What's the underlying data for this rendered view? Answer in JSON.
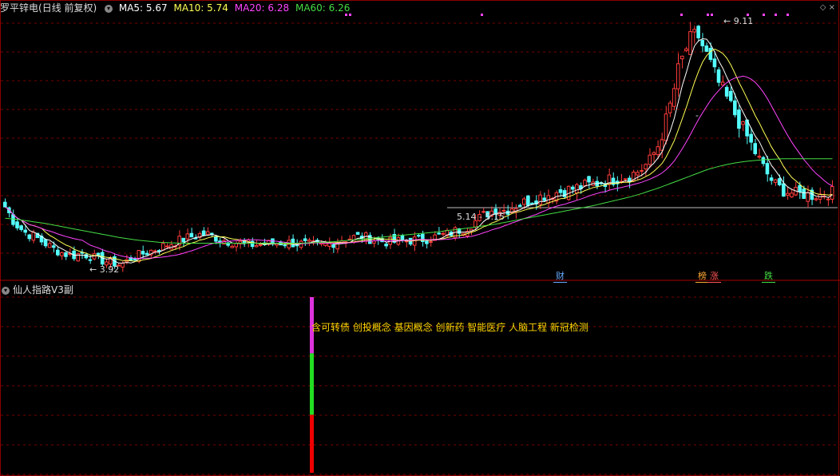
{
  "header": {
    "stock_name": "罗平锌电",
    "period": "(日线 前复权)",
    "ma5_label": "MA5: 5.67",
    "ma10_label": "MA10: 5.74",
    "ma20_label": "MA20: 6.28",
    "ma60_label": "MA60: 6.26"
  },
  "colors": {
    "up": "#ff3c3c",
    "down": "#54ffff",
    "ma5": "#ffffff",
    "ma10": "#ffff55",
    "ma20": "#ff44ff",
    "ma60": "#44dd44",
    "grid": "#7a0000"
  },
  "annotations": {
    "high_label": "9.11",
    "low_label": "3.92",
    "range_label": "5.14 - 5.15",
    "dash_label": "-"
  },
  "event_tags": [
    {
      "text": "财",
      "color": "#66aaff"
    },
    {
      "text": "榜",
      "color": "#ffaa33"
    },
    {
      "text": "涨",
      "color": "#ff5555"
    },
    {
      "text": "跌",
      "color": "#44dd44"
    }
  ],
  "indicator": {
    "title": "仙人指路V3副",
    "concepts": "含可转债 创投概念 基因概念 创新药 智能医疗 人脑工程 新冠检测",
    "bar_segments": [
      {
        "color": "#dd33dd",
        "from": 0.68,
        "to": 1.0
      },
      {
        "color": "#22dd22",
        "from": 0.33,
        "to": 0.68
      },
      {
        "color": "#ee0000",
        "from": 0.0,
        "to": 0.33
      }
    ]
  },
  "chart_data": {
    "type": "candlestick",
    "ylim": [
      3.6,
      9.4
    ],
    "high_value": 9.11,
    "low_value": 3.92,
    "close_series": [
      5.2,
      4.85,
      4.65,
      4.55,
      4.42,
      4.28,
      4.18,
      4.12,
      4.18,
      4.1,
      4.02,
      3.98,
      3.92,
      4.05,
      4.15,
      4.22,
      4.3,
      4.38,
      4.45,
      4.52,
      4.58,
      4.6,
      4.52,
      4.45,
      4.42,
      4.38,
      4.36,
      4.38,
      4.4,
      4.42,
      4.4,
      4.38,
      4.36,
      4.35,
      4.4,
      4.48,
      4.52,
      4.55,
      4.5,
      4.45,
      4.42,
      4.44,
      4.46,
      4.48,
      4.5,
      4.55,
      4.6,
      4.68,
      4.75,
      4.9,
      5.05,
      5.15,
      5.12,
      5.22,
      5.3,
      5.38,
      5.45,
      5.5,
      5.55,
      5.6,
      5.65,
      5.7,
      5.75,
      5.8,
      5.85,
      5.9,
      6.0,
      6.2,
      6.6,
      7.3,
      8.2,
      8.8,
      9.0,
      8.5,
      8.0,
      7.6,
      7.2,
      6.8,
      6.4,
      6.0,
      5.7,
      5.55,
      5.5,
      5.48,
      5.45,
      5.48,
      5.52
    ],
    "ma60_series": [
      4.95,
      4.93,
      4.9,
      4.87,
      4.84,
      4.8,
      4.76,
      4.72,
      4.68,
      4.64,
      4.6,
      4.56,
      4.52,
      4.49,
      4.46,
      4.44,
      4.42,
      4.41,
      4.4,
      4.4,
      4.4,
      4.4,
      4.4,
      4.4,
      4.4,
      4.4,
      4.4,
      4.4,
      4.4,
      4.4,
      4.4,
      4.4,
      4.41,
      4.42,
      4.43,
      4.45,
      4.47,
      4.49,
      4.51,
      4.53,
      4.55,
      4.57,
      4.59,
      4.61,
      4.63,
      4.65,
      4.68,
      4.7,
      4.73,
      4.76,
      4.79,
      4.82,
      4.86,
      4.9,
      4.94,
      4.98,
      5.02,
      5.06,
      5.1,
      5.14,
      5.18,
      5.22,
      5.27,
      5.32,
      5.37,
      5.42,
      5.48,
      5.55,
      5.62,
      5.7,
      5.78,
      5.86,
      5.94,
      6.02,
      6.08,
      6.13,
      6.17,
      6.2,
      6.22,
      6.24,
      6.25,
      6.26,
      6.26,
      6.26,
      6.26,
      6.26,
      6.26
    ],
    "reference_line": 5.15
  }
}
